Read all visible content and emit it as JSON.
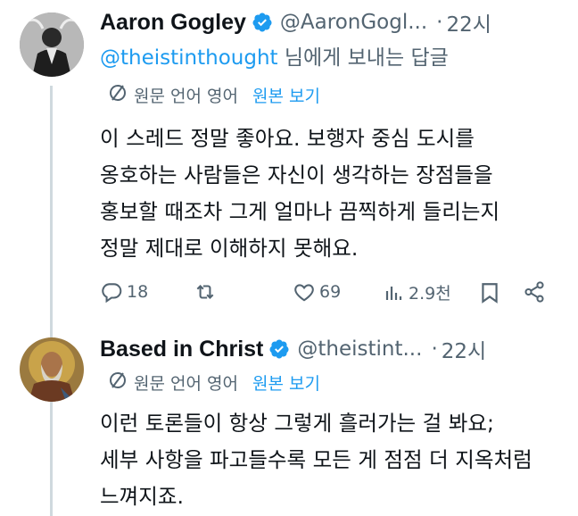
{
  "post1": {
    "author_name": "Aaron Gogley",
    "handle": "@AaronGogl...",
    "separator": "·",
    "time": "22시",
    "reply_mention": "@theistinthought",
    "reply_suffix": " 님에게 보내는 답글",
    "translate_lang": "원문 언어 영어",
    "translate_action": "원본 보기",
    "lines": [
      "이 스레드 정말 좋아요. 보행자 중심 도시를",
      "옹호하는 사람들은 자신이 생각하는 장점들을",
      "홍보할 때조차 그게 얼마나 끔찍하게 들리는지",
      "정말 제대로 이해하지 못해요."
    ],
    "actions": {
      "replies": "18",
      "reposts": "",
      "likes": "69",
      "views": "2.9천"
    }
  },
  "post2": {
    "author_name": "Based in Christ",
    "handle": "@theistint...",
    "separator": "·",
    "time": "22시",
    "translate_lang": "원문 언어 영어",
    "translate_action": "원본 보기",
    "lines": [
      "이런 토론들이 항상 그렇게 흘러가는 걸 봐요;",
      "세부 사항을 파고들수록 모든 게 점점 더 지옥처럼",
      "느껴지죠."
    ]
  },
  "colors": {
    "link": "#1d9bf0",
    "secondary": "#536471",
    "text": "#0f1419",
    "thread_line": "#cfd9de"
  },
  "icons": [
    "verified-badge-icon",
    "translate-icon",
    "reply-icon",
    "repost-icon",
    "like-icon",
    "views-icon",
    "bookmark-icon",
    "share-icon"
  ]
}
